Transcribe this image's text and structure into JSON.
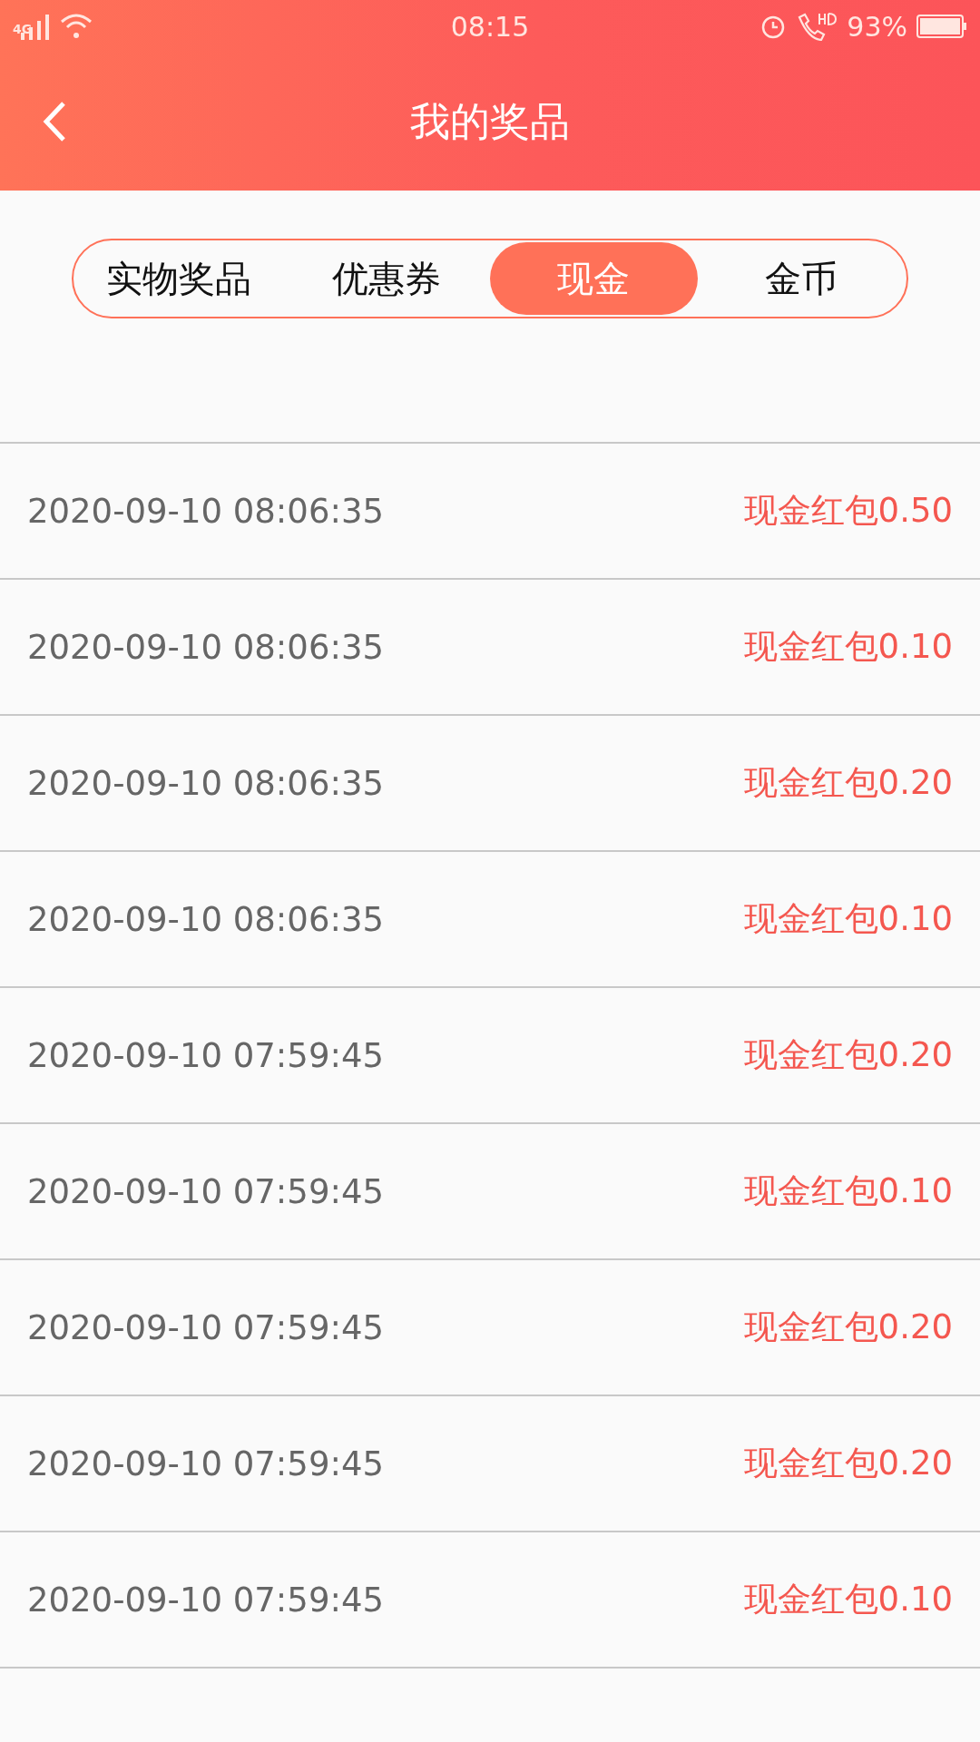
{
  "status_bar": {
    "network": "4G",
    "time": "08:15",
    "battery": "93%"
  },
  "header": {
    "title": "我的奖品"
  },
  "tabs": [
    {
      "label": "实物奖品",
      "selected": false
    },
    {
      "label": "优惠券",
      "selected": false
    },
    {
      "label": "现金",
      "selected": true
    },
    {
      "label": "金币",
      "selected": false
    }
  ],
  "records": [
    {
      "time": "2020-09-10 08:06:35",
      "prize": "现金红包0.50"
    },
    {
      "time": "2020-09-10 08:06:35",
      "prize": "现金红包0.10"
    },
    {
      "time": "2020-09-10 08:06:35",
      "prize": "现金红包0.20"
    },
    {
      "time": "2020-09-10 08:06:35",
      "prize": "现金红包0.10"
    },
    {
      "time": "2020-09-10 07:59:45",
      "prize": "现金红包0.20"
    },
    {
      "time": "2020-09-10 07:59:45",
      "prize": "现金红包0.10"
    },
    {
      "time": "2020-09-10 07:59:45",
      "prize": "现金红包0.20"
    },
    {
      "time": "2020-09-10 07:59:45",
      "prize": "现金红包0.20"
    },
    {
      "time": "2020-09-10 07:59:45",
      "prize": "现金红包0.10"
    }
  ]
}
